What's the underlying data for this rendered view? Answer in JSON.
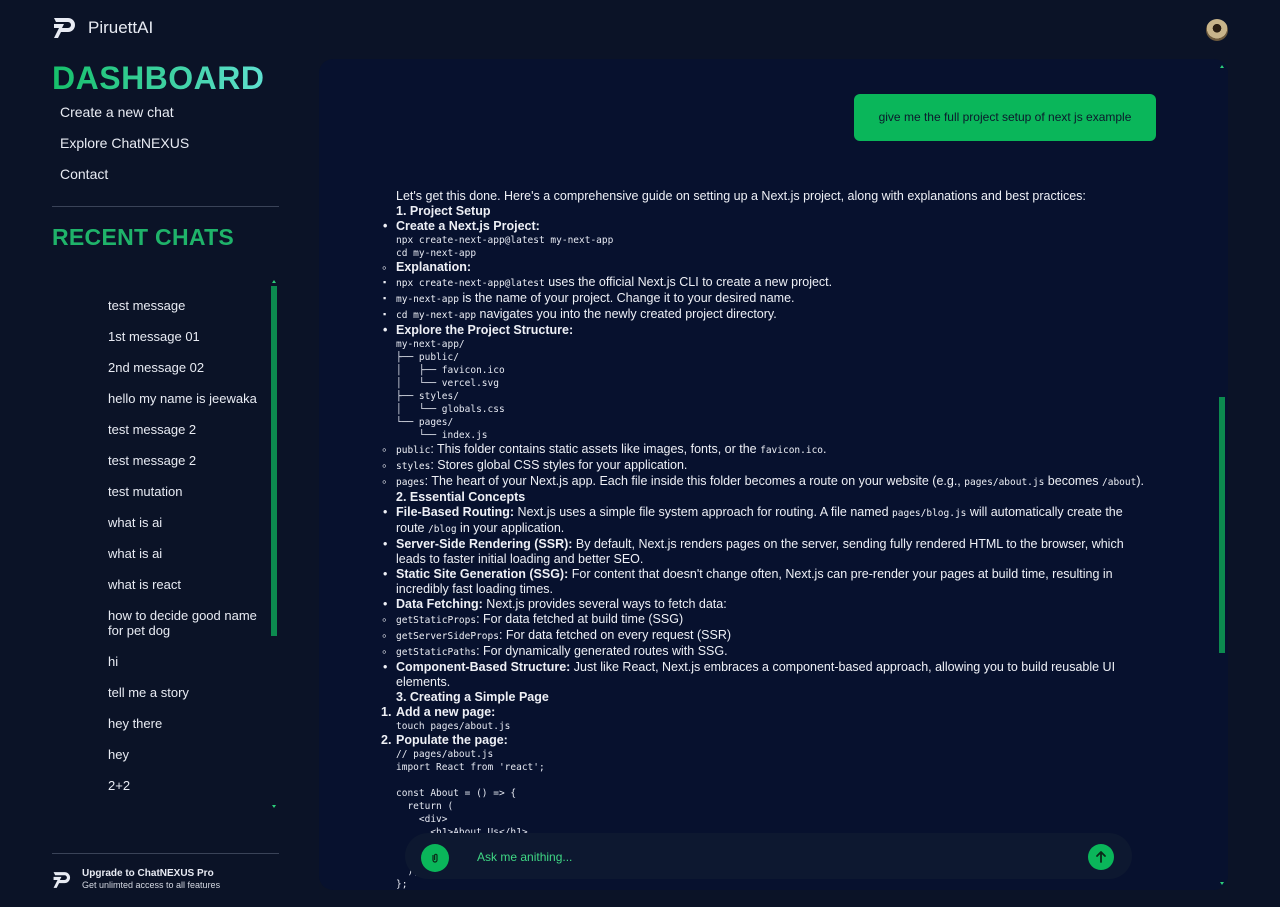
{
  "app": {
    "name": "PiruettAI",
    "logo_icon": "piruett-logo-icon",
    "avatar_icon": "user-avatar-icon"
  },
  "sidebar": {
    "title": "DASHBOARD",
    "nav": [
      {
        "label": "Create a new chat"
      },
      {
        "label": "Explore ChatNEXUS"
      },
      {
        "label": "Contact"
      }
    ],
    "recent_title": "RECENT CHATS",
    "chats": [
      {
        "label": "test message"
      },
      {
        "label": "1st message 01"
      },
      {
        "label": "2nd message 02"
      },
      {
        "label": "hello my name is jeewaka"
      },
      {
        "label": "test message 2"
      },
      {
        "label": "test message 2"
      },
      {
        "label": "test mutation"
      },
      {
        "label": "what is ai"
      },
      {
        "label": "what is ai"
      },
      {
        "label": "what is react"
      },
      {
        "label": "how to decide good name for pet dog"
      },
      {
        "label": "hi"
      },
      {
        "label": "tell me a story"
      },
      {
        "label": "hey there"
      },
      {
        "label": "hey"
      },
      {
        "label": "2+2"
      }
    ],
    "upgrade": {
      "title": "Upgrade to ChatNEXUS Pro",
      "subtitle": "Get unlimted access to all features"
    }
  },
  "chat": {
    "user_message": "give me the full project setup of next js example",
    "answer": {
      "intro": "Let's get this done. Here's a comprehensive guide on setting up a Next.js project, along with explanations and best practices:",
      "s1": "1. Project Setup",
      "create_heading": "Create a Next.js Project:",
      "create_code": "npx create-next-app@latest my-next-app\ncd my-next-app",
      "explanation_heading": "Explanation:",
      "exp1_code": "npx create-next-app@latest",
      "exp1_text": " uses the official Next.js CLI to create a new project.",
      "exp2_code": "my-next-app",
      "exp2_text": " is the name of your project. Change it to your desired name.",
      "exp3_code": "cd my-next-app",
      "exp3_text": " navigates you into the newly created project directory.",
      "structure_heading": "Explore the Project Structure:",
      "structure_code": "my-next-app/\n├── public/\n│   ├── favicon.ico\n│   └── vercel.svg\n├── styles/\n│   └── globals.css\n└── pages/\n    └── index.js",
      "public_code": "public",
      "public_text": ": This folder contains static assets like images, fonts, or the ",
      "public_code2": "favicon.ico",
      "public_end": ".",
      "styles_code": "styles",
      "styles_text": ": Stores global CSS styles for your application.",
      "pages_code": "pages",
      "pages_text": ": The heart of your Next.js app. Each file inside this folder becomes a route on your website (e.g., ",
      "pages_code2": "pages/about.js",
      "pages_mid": " becomes ",
      "pages_code3": "/about",
      "pages_end": ").",
      "s2": "2. Essential Concepts",
      "fbr_bold": "File-Based Routing:",
      "fbr_text": " Next.js uses a simple file system approach for routing. A file named ",
      "fbr_code": "pages/blog.js",
      "fbr_mid": " will automatically create the route ",
      "fbr_code2": "/blog",
      "fbr_end": " in your application.",
      "ssr_bold": "Server-Side Rendering (SSR):",
      "ssr_text": " By default, Next.js renders pages on the server, sending fully rendered HTML to the browser, which leads to faster initial loading and better SEO.",
      "ssg_bold": "Static Site Generation (SSG):",
      "ssg_text": " For content that doesn't change often, Next.js can pre-render your pages at build time, resulting in incredibly fast loading times.",
      "df_bold": "Data Fetching:",
      "df_text": " Next.js provides several ways to fetch data:",
      "gsp_code": "getStaticProps",
      "gsp_text": ": For data fetched at build time (SSG)",
      "gssp_code": "getServerSideProps",
      "gssp_text": ": For data fetched on every request (SSR)",
      "gspa_code": "getStaticPaths",
      "gspa_text": ": For dynamically generated routes with SSG.",
      "cbs_bold": "Component-Based Structure:",
      "cbs_text": " Just like React, Next.js embraces a component-based approach, allowing you to build reusable UI elements.",
      "s3": "3. Creating a Simple Page",
      "add_num": "1.",
      "add_heading": "Add a new page:",
      "add_code": "touch pages/about.js",
      "pop_num": "2.",
      "pop_heading": "Populate the page:",
      "pop_code": "// pages/about.js\nimport React from 'react';\n\nconst About = () => {\n  return (\n    <div>\n      <h1>About Us</h1>\n      <p>This is the about page.</p>\n    </div>\n  );\n};"
    }
  },
  "input": {
    "placeholder": "Ask me anithing...",
    "attach_icon": "paperclip-icon",
    "send_icon": "arrow-up-icon"
  },
  "colors": {
    "accent": "#0ab65a",
    "background": "#0b1327",
    "panel": "#07112e"
  }
}
